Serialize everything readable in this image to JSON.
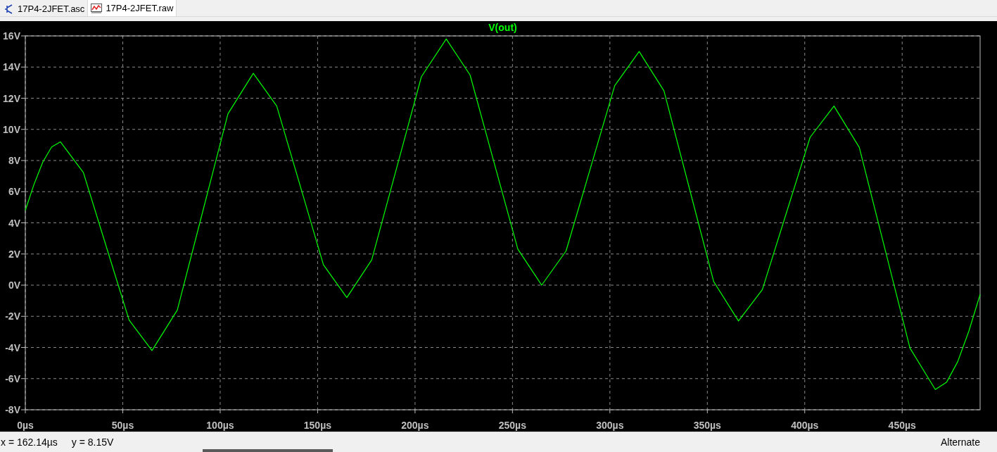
{
  "tabs": [
    {
      "label": "17P4-2JFET.asc",
      "kind": "schematic",
      "selected": false
    },
    {
      "label": "17P4-2JFET.raw",
      "kind": "waveform",
      "selected": true
    }
  ],
  "plot": {
    "chart_data": {
      "type": "line",
      "grid": true,
      "x": [
        0,
        4.5,
        9,
        13.5,
        18,
        29.75,
        41.5,
        53.25,
        65,
        78,
        91,
        104,
        117,
        129,
        141,
        153,
        165,
        177.75,
        190.5,
        203.25,
        216,
        228.25,
        240.5,
        252.75,
        265,
        277.5,
        290,
        302.5,
        315,
        327.75,
        340.5,
        353.25,
        366,
        378.25,
        390.5,
        402.75,
        415,
        428,
        441,
        454,
        467,
        472.75,
        478.5,
        484.25,
        490
      ],
      "series": [
        {
          "name": "V(out)",
          "color": "#00ff00",
          "values": [
            4.8,
            6.49,
            7.91,
            8.87,
            9.2,
            7.24,
            2.5,
            -2.24,
            -4.2,
            -1.6,
            4.7,
            11.0,
            13.6,
            11.5,
            6.4,
            1.3,
            -0.8,
            1.62,
            7.5,
            13.38,
            15.8,
            13.49,
            7.9,
            2.31,
            0,
            2.19,
            7.5,
            12.81,
            15,
            12.47,
            6.35,
            0.23,
            -2.3,
            -0.29,
            4.6,
            9.49,
            11.5,
            8.84,
            2.4,
            -4.04,
            -6.7,
            -6.24,
            -4.91,
            -2.94,
            -0.6
          ]
        }
      ],
      "xlim": [
        0,
        490
      ],
      "ylim": [
        -8,
        16
      ],
      "xticks": [
        {
          "value": 0,
          "label": "0µs"
        },
        {
          "value": 50,
          "label": "50µs"
        },
        {
          "value": 100,
          "label": "100µs"
        },
        {
          "value": 150,
          "label": "150µs"
        },
        {
          "value": 200,
          "label": "200µs"
        },
        {
          "value": 250,
          "label": "250µs"
        },
        {
          "value": 300,
          "label": "300µs"
        },
        {
          "value": 350,
          "label": "350µs"
        },
        {
          "value": 400,
          "label": "400µs"
        },
        {
          "value": 450,
          "label": "450µs"
        }
      ],
      "yticks": [
        {
          "value": 16,
          "label": "16V"
        },
        {
          "value": 14,
          "label": "14V"
        },
        {
          "value": 12,
          "label": "12V"
        },
        {
          "value": 10,
          "label": "10V"
        },
        {
          "value": 8,
          "label": "8V"
        },
        {
          "value": 6,
          "label": "6V"
        },
        {
          "value": 4,
          "label": "4V"
        },
        {
          "value": 2,
          "label": "2V"
        },
        {
          "value": 0,
          "label": "0V"
        },
        {
          "value": -2,
          "label": "-2V"
        },
        {
          "value": -4,
          "label": "-4V"
        },
        {
          "value": -6,
          "label": "-6V"
        },
        {
          "value": -8,
          "label": "-8V"
        }
      ]
    }
  },
  "status_bar": {
    "cursor_x": "x = 162.14µs",
    "cursor_y": "y = 8.15V",
    "mode": "Alternate"
  }
}
